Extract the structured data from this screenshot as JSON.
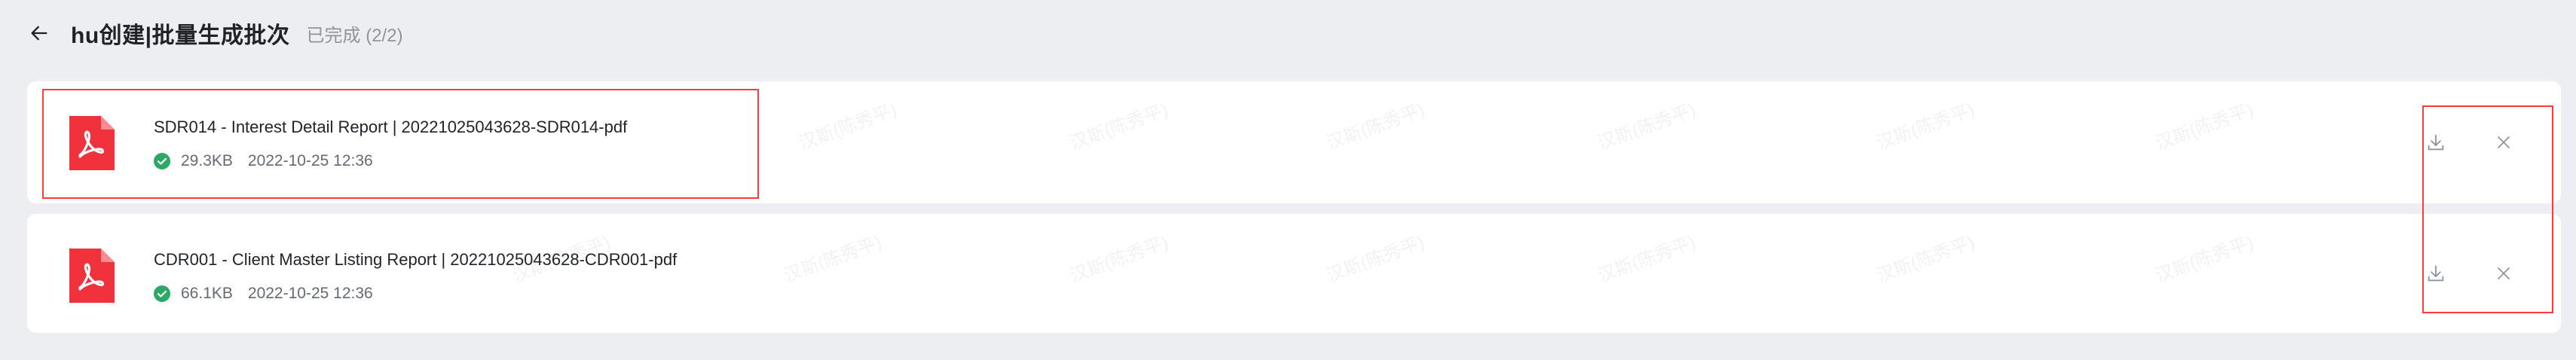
{
  "header": {
    "title": "hu创建|批量生成批次",
    "status": "已完成 (2/2)"
  },
  "watermark_text": "汉斯(陈秀平)",
  "files": [
    {
      "name": "SDR014 - Interest Detail Report | 20221025043628-SDR014-pdf",
      "size": "29.3KB",
      "time": "2022-10-25 12:36"
    },
    {
      "name": "CDR001 - Client Master Listing Report | 20221025043628-CDR001-pdf",
      "size": "66.1KB",
      "time": "2022-10-25 12:36"
    }
  ],
  "colors": {
    "pdf_red": "#f0323c",
    "success_green": "#2ea867",
    "highlight_red": "#ff3b3b"
  }
}
